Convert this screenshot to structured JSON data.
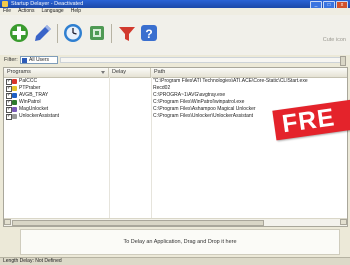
{
  "window": {
    "title": "Startup Delayer - Deactivated",
    "controls": [
      "_",
      "□",
      "x"
    ]
  },
  "menubar": {
    "items": [
      "File",
      "Actions",
      "Language",
      "Help"
    ]
  },
  "toolbar": {
    "buttons": [
      {
        "icon": "add-plus-icon",
        "color": "#3a9b2e"
      },
      {
        "icon": "edit-pencil-icon",
        "color": "#3a64c8"
      },
      {
        "icon": "clock-delay-icon",
        "color": "#2f7fd0"
      },
      {
        "icon": "registry-icon",
        "color": "#4f9a54"
      },
      {
        "icon": "filter-funnel-icon",
        "color": "#d23a2e"
      },
      {
        "icon": "help-question-icon",
        "color": "#3a6fcf"
      }
    ],
    "help_hint": "Cute icon"
  },
  "filter": {
    "label": "Filter:",
    "value": "All Users"
  },
  "list": {
    "columns": [
      {
        "label": "Programs"
      },
      {
        "label": "Delay"
      },
      {
        "label": "Path"
      }
    ],
    "rows": [
      {
        "name": "PalCCC",
        "delay": "",
        "path": "\"C:\\Program Files\\ATI Technologies\\ATI.ACE\\Core-Static\\CLIStart.exe",
        "icon_color": "#d8352b"
      },
      {
        "name": "PTPraber",
        "delay": "",
        "path": "Recd02",
        "icon_color": "#e5c42b"
      },
      {
        "name": "AVGB_TRAY",
        "delay": "",
        "path": "C:\\PROGRA~1\\AVG\\avgtray.exe",
        "icon_color": "#1f5fc4"
      },
      {
        "name": "WinPatrol",
        "delay": "",
        "path": "C:\\Program Files\\WinPatrol\\winpatrol.exe",
        "icon_color": "#2d7a2d"
      },
      {
        "name": "MagUnlocket",
        "delay": "",
        "path": "C:\\Program Files\\Ashampoo Magical Unlocker",
        "icon_color": "#7a5ab8"
      },
      {
        "name": "UnlockerAssistant",
        "delay": "",
        "path": "C:\\Program Files\\Unlocker\\UnlockerAssistant",
        "icon_color": "#9a9a9a"
      }
    ]
  },
  "promo": {
    "text": "FRE"
  },
  "dropzone": {
    "text": "To Delay an Application, Drag and Drop it here"
  },
  "statusbar": {
    "text": "Length Delay: Not Defined"
  }
}
